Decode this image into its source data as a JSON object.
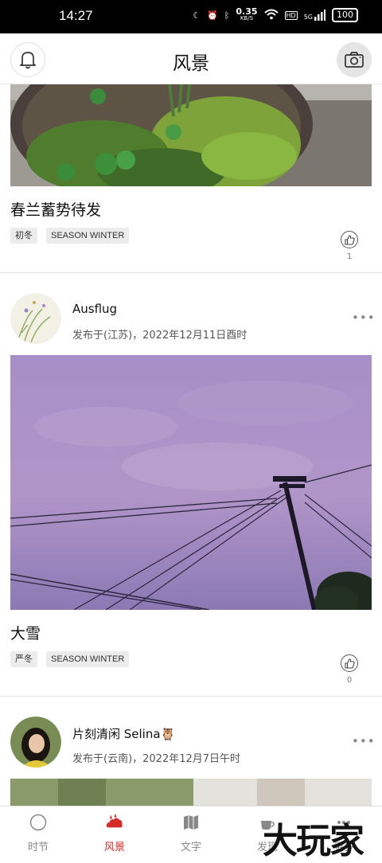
{
  "status_bar": {
    "time": "14:27",
    "net_speed": "0.35",
    "net_unit": "KB/S",
    "hd": "HD",
    "signal": "5G",
    "battery": "100"
  },
  "header": {
    "title": "风景"
  },
  "posts": [
    {
      "title": "春兰蓄势待发",
      "tags": [
        "初冬",
        "SEASON WINTER"
      ],
      "likes": "1"
    },
    {
      "author": "Ausflug",
      "meta": "发布于(江苏)，2022年12月11日酉时",
      "title": "大雪",
      "tags": [
        "严冬",
        "SEASON WINTER"
      ],
      "likes": "0"
    },
    {
      "author": "片刻清闲 Selina🦉",
      "meta": "发布于(云南)，2022年12月7日午时"
    }
  ],
  "more_label": "•••",
  "tabbar": {
    "items": [
      {
        "label": "时节",
        "icon": "compass-icon"
      },
      {
        "label": "风景",
        "icon": "cloud-fire-icon"
      },
      {
        "label": "文字",
        "icon": "map-icon"
      },
      {
        "label": "发现",
        "icon": "coffee-icon"
      },
      {
        "label": "更多",
        "icon": "more-icon"
      }
    ],
    "active": "风景",
    "active_color": "#d42a2a"
  },
  "watermark": "大玩家"
}
